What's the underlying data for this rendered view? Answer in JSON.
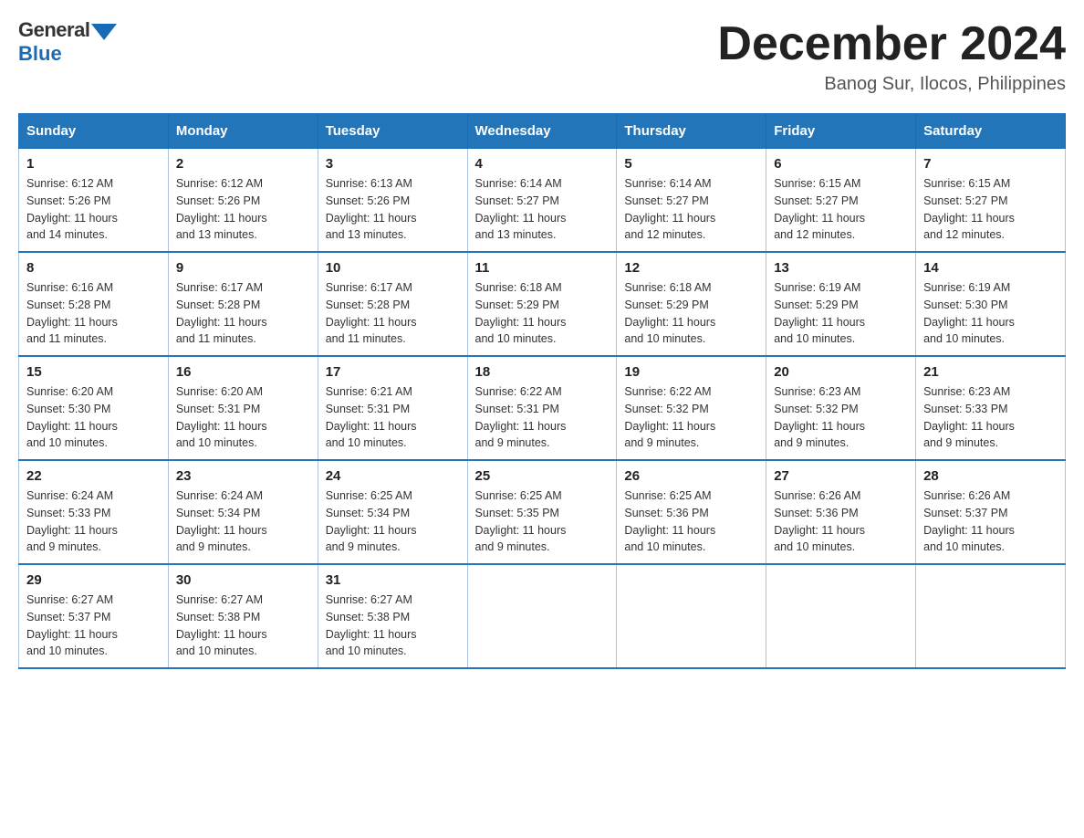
{
  "logo": {
    "general": "General",
    "blue": "Blue"
  },
  "title": "December 2024",
  "subtitle": "Banog Sur, Ilocos, Philippines",
  "days_of_week": [
    "Sunday",
    "Monday",
    "Tuesday",
    "Wednesday",
    "Thursday",
    "Friday",
    "Saturday"
  ],
  "weeks": [
    [
      {
        "day": "1",
        "sunrise": "6:12 AM",
        "sunset": "5:26 PM",
        "daylight": "11 hours and 14 minutes."
      },
      {
        "day": "2",
        "sunrise": "6:12 AM",
        "sunset": "5:26 PM",
        "daylight": "11 hours and 13 minutes."
      },
      {
        "day": "3",
        "sunrise": "6:13 AM",
        "sunset": "5:26 PM",
        "daylight": "11 hours and 13 minutes."
      },
      {
        "day": "4",
        "sunrise": "6:14 AM",
        "sunset": "5:27 PM",
        "daylight": "11 hours and 13 minutes."
      },
      {
        "day": "5",
        "sunrise": "6:14 AM",
        "sunset": "5:27 PM",
        "daylight": "11 hours and 12 minutes."
      },
      {
        "day": "6",
        "sunrise": "6:15 AM",
        "sunset": "5:27 PM",
        "daylight": "11 hours and 12 minutes."
      },
      {
        "day": "7",
        "sunrise": "6:15 AM",
        "sunset": "5:27 PM",
        "daylight": "11 hours and 12 minutes."
      }
    ],
    [
      {
        "day": "8",
        "sunrise": "6:16 AM",
        "sunset": "5:28 PM",
        "daylight": "11 hours and 11 minutes."
      },
      {
        "day": "9",
        "sunrise": "6:17 AM",
        "sunset": "5:28 PM",
        "daylight": "11 hours and 11 minutes."
      },
      {
        "day": "10",
        "sunrise": "6:17 AM",
        "sunset": "5:28 PM",
        "daylight": "11 hours and 11 minutes."
      },
      {
        "day": "11",
        "sunrise": "6:18 AM",
        "sunset": "5:29 PM",
        "daylight": "11 hours and 10 minutes."
      },
      {
        "day": "12",
        "sunrise": "6:18 AM",
        "sunset": "5:29 PM",
        "daylight": "11 hours and 10 minutes."
      },
      {
        "day": "13",
        "sunrise": "6:19 AM",
        "sunset": "5:29 PM",
        "daylight": "11 hours and 10 minutes."
      },
      {
        "day": "14",
        "sunrise": "6:19 AM",
        "sunset": "5:30 PM",
        "daylight": "11 hours and 10 minutes."
      }
    ],
    [
      {
        "day": "15",
        "sunrise": "6:20 AM",
        "sunset": "5:30 PM",
        "daylight": "11 hours and 10 minutes."
      },
      {
        "day": "16",
        "sunrise": "6:20 AM",
        "sunset": "5:31 PM",
        "daylight": "11 hours and 10 minutes."
      },
      {
        "day": "17",
        "sunrise": "6:21 AM",
        "sunset": "5:31 PM",
        "daylight": "11 hours and 10 minutes."
      },
      {
        "day": "18",
        "sunrise": "6:22 AM",
        "sunset": "5:31 PM",
        "daylight": "11 hours and 9 minutes."
      },
      {
        "day": "19",
        "sunrise": "6:22 AM",
        "sunset": "5:32 PM",
        "daylight": "11 hours and 9 minutes."
      },
      {
        "day": "20",
        "sunrise": "6:23 AM",
        "sunset": "5:32 PM",
        "daylight": "11 hours and 9 minutes."
      },
      {
        "day": "21",
        "sunrise": "6:23 AM",
        "sunset": "5:33 PM",
        "daylight": "11 hours and 9 minutes."
      }
    ],
    [
      {
        "day": "22",
        "sunrise": "6:24 AM",
        "sunset": "5:33 PM",
        "daylight": "11 hours and 9 minutes."
      },
      {
        "day": "23",
        "sunrise": "6:24 AM",
        "sunset": "5:34 PM",
        "daylight": "11 hours and 9 minutes."
      },
      {
        "day": "24",
        "sunrise": "6:25 AM",
        "sunset": "5:34 PM",
        "daylight": "11 hours and 9 minutes."
      },
      {
        "day": "25",
        "sunrise": "6:25 AM",
        "sunset": "5:35 PM",
        "daylight": "11 hours and 9 minutes."
      },
      {
        "day": "26",
        "sunrise": "6:25 AM",
        "sunset": "5:36 PM",
        "daylight": "11 hours and 10 minutes."
      },
      {
        "day": "27",
        "sunrise": "6:26 AM",
        "sunset": "5:36 PM",
        "daylight": "11 hours and 10 minutes."
      },
      {
        "day": "28",
        "sunrise": "6:26 AM",
        "sunset": "5:37 PM",
        "daylight": "11 hours and 10 minutes."
      }
    ],
    [
      {
        "day": "29",
        "sunrise": "6:27 AM",
        "sunset": "5:37 PM",
        "daylight": "11 hours and 10 minutes."
      },
      {
        "day": "30",
        "sunrise": "6:27 AM",
        "sunset": "5:38 PM",
        "daylight": "11 hours and 10 minutes."
      },
      {
        "day": "31",
        "sunrise": "6:27 AM",
        "sunset": "5:38 PM",
        "daylight": "11 hours and 10 minutes."
      },
      null,
      null,
      null,
      null
    ]
  ],
  "labels": {
    "sunrise": "Sunrise:",
    "sunset": "Sunset:",
    "daylight": "Daylight:"
  }
}
